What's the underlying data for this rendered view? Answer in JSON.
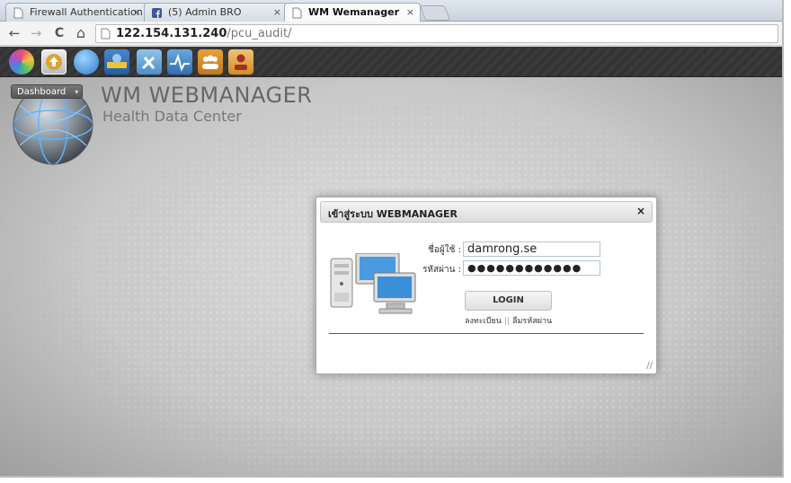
{
  "browser": {
    "tabs": [
      {
        "label": "Firewall Authentication I",
        "close": "×",
        "active": false
      },
      {
        "label": "(5) Admin BRO",
        "close": "×",
        "active": false
      },
      {
        "label": "WM Wemanager",
        "close": "×",
        "active": true
      }
    ],
    "nav": {
      "back": "←",
      "forward": "→",
      "reload": "C",
      "home": "⌂"
    },
    "url_host": "122.154.131.240",
    "url_path": "/pcu_audit/"
  },
  "appbar": {
    "icons": [
      "color-wheel-icon",
      "upload-icon",
      "globe-icon",
      "hdc-icon",
      "tools-icon",
      "pulse-icon",
      "users-icon",
      "user-icon"
    ],
    "colors": [
      "#e84b7a",
      "#c9c9c9",
      "#3b8ed8",
      "#2b6cb0",
      "#5aa7d6",
      "#4a8ccf",
      "#d78a1e",
      "#e0a23a"
    ]
  },
  "header": {
    "dashboard_label": "Dashboard",
    "caret": "▾",
    "brand_title": "WM WEBMANAGER",
    "brand_subtitle": "Health Data Center"
  },
  "dialog": {
    "title": "เข้าสู่ระบบ WEBMANAGER",
    "close": "×",
    "username_label": "ชื่อผู้ใช้ :",
    "username_value": "damrong.se",
    "password_label": "รหัสผ่าน :",
    "password_value": "●●●●●●●●●●●●",
    "login_label": "LOGIN",
    "register_link": "ลงทะเบียน",
    "separator": "||",
    "forgot_link": "ลืมรหัสผ่าน",
    "resize_grip": "//"
  }
}
